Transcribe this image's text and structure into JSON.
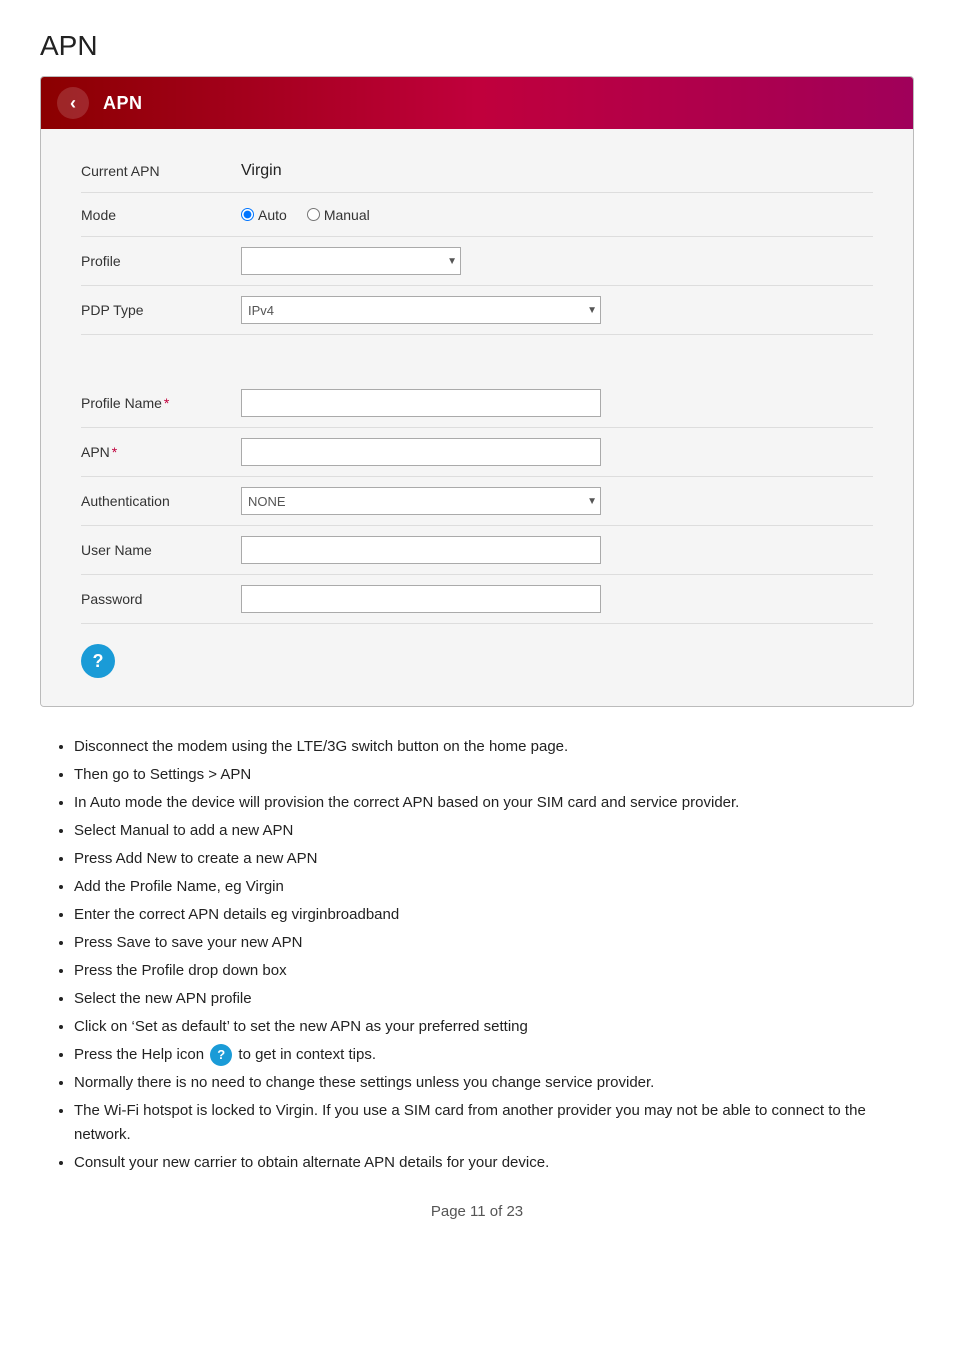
{
  "page": {
    "title": "APN",
    "footer": "Page 11 of 23"
  },
  "header": {
    "back_label": "‹",
    "title": "APN"
  },
  "form": {
    "current_apn_label": "Current APN",
    "current_apn_value": "Virgin",
    "mode_label": "Mode",
    "mode_auto": "Auto",
    "mode_manual": "Manual",
    "profile_label": "Profile",
    "profile_placeholder": "",
    "pdp_type_label": "PDP Type",
    "pdp_type_value": "IPv4",
    "profile_name_label": "Profile Name",
    "profile_name_required": "*",
    "apn_label": "APN",
    "apn_required": "*",
    "authentication_label": "Authentication",
    "authentication_value": "NONE",
    "username_label": "User Name",
    "password_label": "Password"
  },
  "instructions": {
    "items": [
      "Disconnect the modem using the LTE/3G switch button on the home page.",
      "Then go to Settings > APN",
      "In Auto mode the device will provision the correct APN based on your SIM card and service provider.",
      "Select Manual to add a new APN",
      "Press Add New to create a new APN",
      "Add the Profile Name, eg Virgin",
      "Enter the correct APN details eg virginbroadband",
      "Press Save to save your new APN",
      "Press the Profile drop down box",
      "Select the new APN profile",
      "Click on 'Set as default' to set the new APN as your preferred setting",
      "Press the Help icon",
      "to get in context tips.",
      "Normally there is no need to change these settings unless you change service provider.",
      "The Wi-Fi hotspot is locked to Virgin. If you use a SIM card from another provider you may not be able to connect to the network.",
      "Consult your new carrier to obtain alternate APN details for your device."
    ],
    "help_icon_label": "?",
    "item_11_pre": "Press the Help icon",
    "item_11_post": "to get in context tips."
  }
}
